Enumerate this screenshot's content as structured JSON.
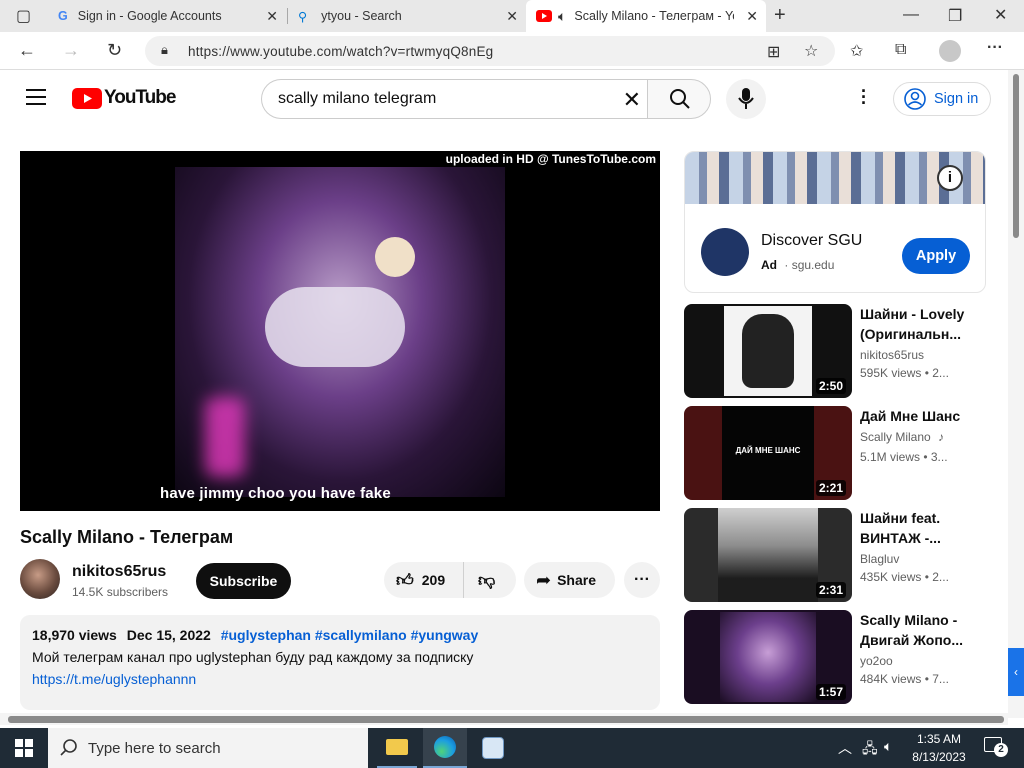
{
  "browser": {
    "tabs": [
      {
        "title": "Sign in - Google Accounts"
      },
      {
        "title": "ytyou - Search"
      },
      {
        "title": "Scally Milano - Телеграм - YouTube"
      }
    ],
    "url": "https://www.youtube.com/watch?v=rtwmyqQ8nEg"
  },
  "youtube": {
    "logo_text": "YouTube",
    "search_value": "scally milano telegram",
    "sign_in": "Sign in"
  },
  "video": {
    "overlay_top": "uploaded in HD @ TunesToTube.com",
    "caption": "have jimmy choo you have fake",
    "title": "Scally Milano - Телеграм",
    "channel": "nikitos65rus",
    "subscribers": "14.5K subscribers",
    "subscribe": "Subscribe",
    "likes": "209",
    "share": "Share",
    "views": "18,970 views",
    "date": "Dec 15, 2022",
    "hashtags": "#uglystephan #scallymilano #yungway",
    "description": "Мой телеграм канал про uglystephan буду рад  каждому за подписку",
    "link": "https://t.me/uglystephannn"
  },
  "ad": {
    "title": "Discover SGU",
    "badge": "Ad",
    "domain": "sgu.edu",
    "cta": "Apply"
  },
  "recommendations": [
    {
      "title": "Шайни - Lovely (Оригинальн...",
      "channel": "nikitos65rus",
      "meta": "595K views  • 2...",
      "duration": "2:50"
    },
    {
      "title": "Дай Мне Шанс",
      "channel": "Scally Milano",
      "meta": "5.1M views  • 3...",
      "duration": "2:21",
      "thumb_text": "ДАЙ МНЕ ШАНС"
    },
    {
      "title": "Шайни feat. ВИНТАЖ -...",
      "channel": "Blagluv",
      "meta": "435K views  • 2...",
      "duration": "2:31"
    },
    {
      "title": "Scally Milano - Двигай Жопо...",
      "channel": "yo2oo",
      "meta": "484K views  • 7...",
      "duration": "1:57"
    }
  ],
  "taskbar": {
    "search_placeholder": "Type here to search",
    "time": "1:35 AM",
    "date": "8/13/2023",
    "notifications": "2"
  }
}
